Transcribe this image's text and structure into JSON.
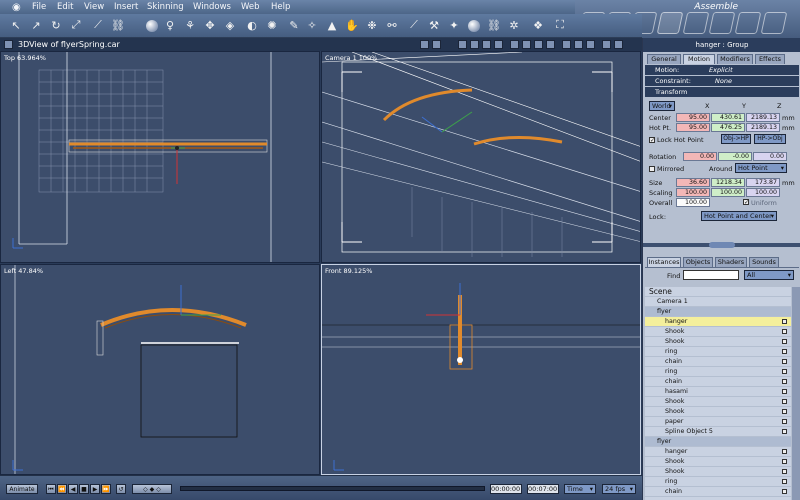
{
  "menubar": {
    "items": [
      "File",
      "Edit",
      "View",
      "Insert",
      "Skinning",
      "Windows",
      "Web",
      "Help"
    ],
    "mode": "Assemble"
  },
  "viewport_header": {
    "title": "3DView of flyerSpring.car"
  },
  "viewports": [
    {
      "label": "Top 63.964%"
    },
    {
      "label": "Camera 1 100%"
    },
    {
      "label": "Left 47.84%"
    },
    {
      "label": "Front 89.125%"
    }
  ],
  "animation": {
    "animate_label": "Animate",
    "time_start": "00:00:00",
    "time_end": "00:07:00",
    "time_mode": "Time",
    "fps": "24 fps"
  },
  "panel": {
    "title": "hanger : Group",
    "tabs": [
      "General",
      "Motion",
      "Modifiers",
      "Effects"
    ],
    "active_tab": "Motion",
    "motion_label": "Motion:",
    "motion_value": "Explicit",
    "constraint_label": "Constraint:",
    "constraint_value": "None",
    "transform_label": "Transform",
    "space": "World",
    "axis_x": "X",
    "axis_y": "Y",
    "axis_z": "Z",
    "unit": "mm",
    "center_label": "Center",
    "center": [
      "95.00",
      "430.61",
      "2189.13"
    ],
    "hotpt_label": "Hot Pt.",
    "hotpt": [
      "95.00",
      "476.25",
      "2189.13"
    ],
    "lock_hot_point": "Lock Hot Point",
    "obj_hp": "Obj->HP",
    "hp_obj": "HP->Obj",
    "rotation_label": "Rotation",
    "rotation": [
      "0.00",
      "-0.00",
      "0.00"
    ],
    "mirrored_label": "Mirrored",
    "around_label": "Around",
    "around_value": "Hot Point",
    "size_label": "Size",
    "size": [
      "36.60",
      "1218.34",
      "173.87"
    ],
    "scaling_label": "Scaling",
    "scaling": [
      "100.00",
      "100.00",
      "100.00"
    ],
    "overall_label": "Overall",
    "overall": "100.00",
    "uniform_label": "Uniform",
    "lock_label": "Lock:",
    "lock_value": "Hot Point and Center"
  },
  "browser": {
    "tabs": [
      "Instances",
      "Objects",
      "Shaders",
      "Sounds"
    ],
    "active_tab": "Instances",
    "find_label": "Find",
    "find_value": "",
    "filter_value": "All",
    "tree": [
      {
        "label": "Scene",
        "depth": 0,
        "type": "header"
      },
      {
        "label": "Camera 1",
        "depth": 1
      },
      {
        "label": "flyer",
        "depth": 1,
        "type": "group"
      },
      {
        "label": "hanger",
        "depth": 2,
        "selected": true
      },
      {
        "label": "Shook",
        "depth": 2
      },
      {
        "label": "Shook",
        "depth": 2
      },
      {
        "label": "ring",
        "depth": 2
      },
      {
        "label": "chain",
        "depth": 2
      },
      {
        "label": "ring",
        "depth": 2
      },
      {
        "label": "chain",
        "depth": 2
      },
      {
        "label": "hasami",
        "depth": 2
      },
      {
        "label": "Shook",
        "depth": 2
      },
      {
        "label": "Shook",
        "depth": 2
      },
      {
        "label": "paper",
        "depth": 2
      },
      {
        "label": "Spline Object 5",
        "depth": 2
      },
      {
        "label": "flyer",
        "depth": 1,
        "type": "group"
      },
      {
        "label": "hanger",
        "depth": 2
      },
      {
        "label": "Shook",
        "depth": 2
      },
      {
        "label": "Shook",
        "depth": 2
      },
      {
        "label": "ring",
        "depth": 2
      },
      {
        "label": "chain",
        "depth": 2
      }
    ]
  }
}
